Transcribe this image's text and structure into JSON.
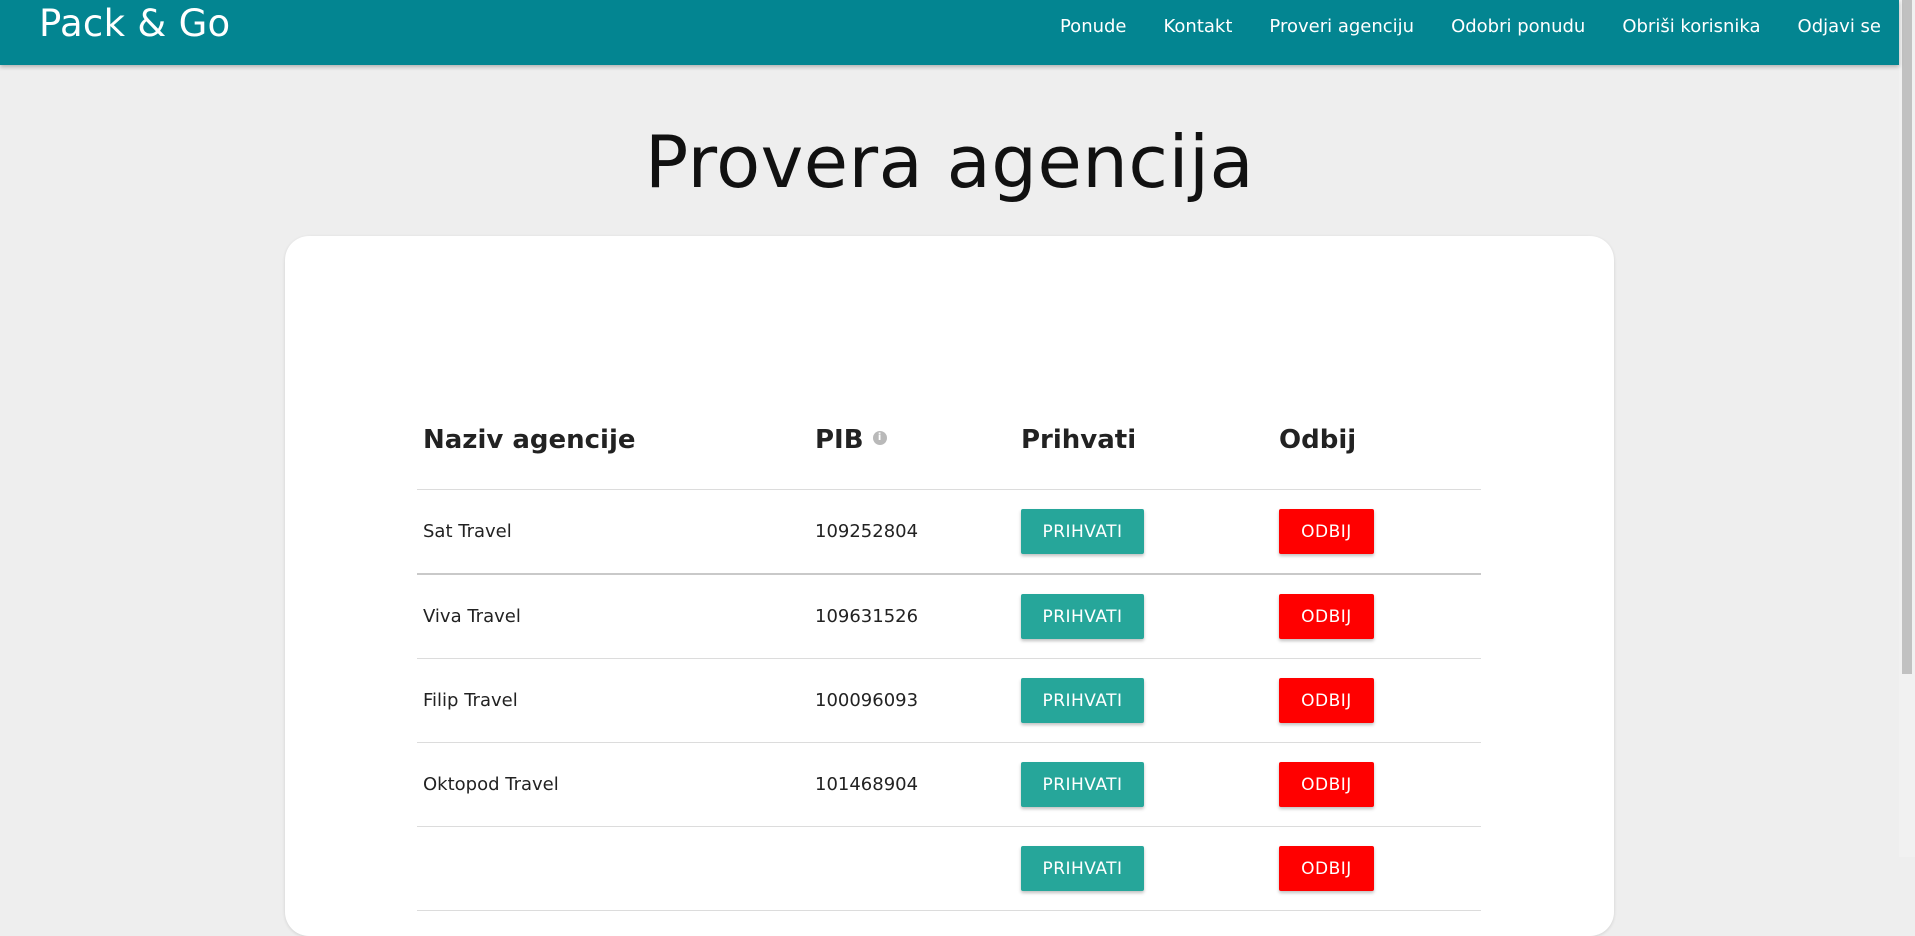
{
  "brand": "Pack & Go",
  "nav": [
    "Ponude",
    "Kontakt",
    "Proveri agenciju",
    "Odobri ponudu",
    "Obriši korisnika",
    "Odjavi se"
  ],
  "page_title": "Provera agencija",
  "table": {
    "headers": {
      "name": "Naziv agencije",
      "pib": "PIB",
      "accept": "Prihvati",
      "reject": "Odbij"
    },
    "rows": [
      {
        "name": "Sat Travel",
        "pib": "109252804"
      },
      {
        "name": "Viva Travel",
        "pib": "109631526"
      },
      {
        "name": "Filip Travel",
        "pib": "100096093"
      },
      {
        "name": "Oktopod Travel",
        "pib": "101468904"
      },
      {
        "name": "",
        "pib": ""
      }
    ],
    "accept_label": "PRIHVATI",
    "reject_label": "ODBIJ"
  },
  "colors": {
    "navbar": "#038591",
    "accept": "#26a69a",
    "reject": "#ff0000",
    "background": "#eeeeee"
  },
  "icons": {
    "pib_info": "info-icon"
  }
}
